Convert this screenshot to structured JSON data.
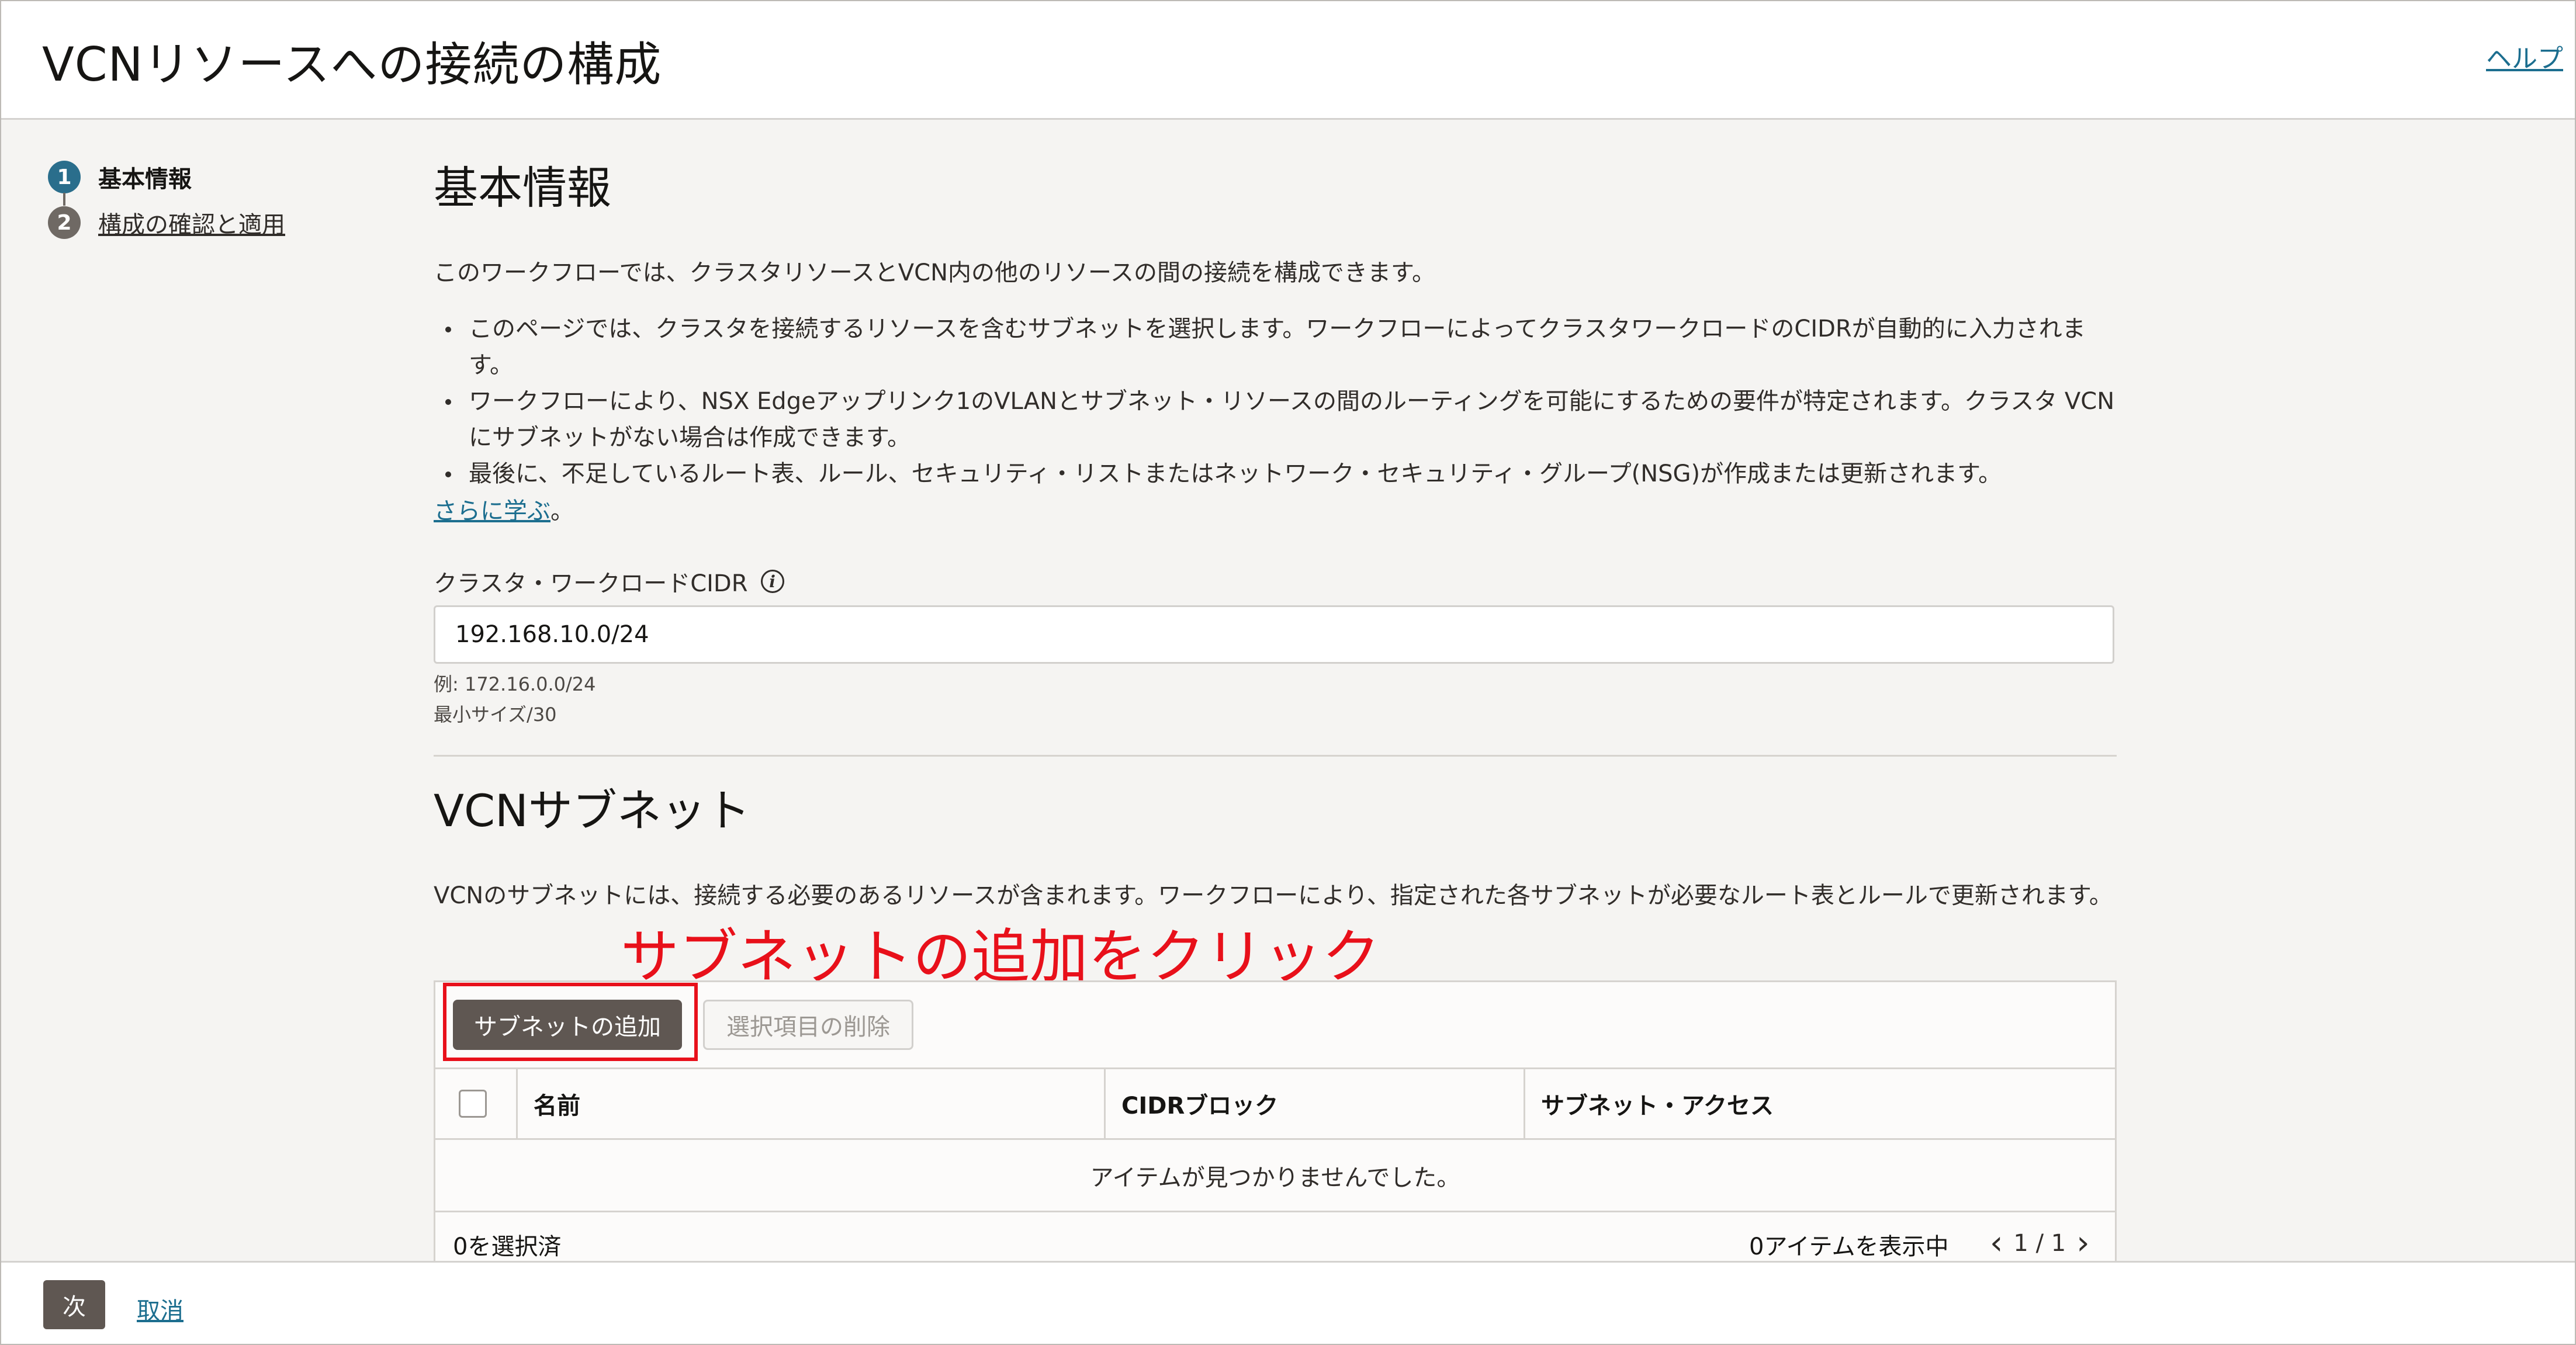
{
  "header": {
    "title": "VCNリソースへの接続の構成",
    "help": "ヘルプ"
  },
  "steps": [
    {
      "number": "1",
      "label": "基本情報",
      "state": "active"
    },
    {
      "number": "2",
      "label": "構成の確認と適用",
      "state": "inactive"
    }
  ],
  "basic": {
    "heading": "基本情報",
    "intro": "このワークフローでは、クラスタリソースとVCN内の他のリソースの間の接続を構成できます。",
    "bullets": [
      "このページでは、クラスタを接続するリソースを含むサブネットを選択します。ワークフローによってクラスタワークロードのCIDRが自動的に入力されます。",
      "ワークフローにより、NSX Edgeアップリンク1のVLANとサブネット・リソースの間のルーティングを可能にするための要件が特定されます。クラスタ VCNにサブネットがない場合は作成できます。",
      "最後に、不足しているルート表、ルール、セキュリティ・リストまたはネットワーク・セキュリティ・グループ(NSG)が作成または更新されます。"
    ],
    "learn_more": "さらに学ぶ",
    "learn_more_suffix": "。",
    "cidr_label": "クラスタ・ワークロードCIDR",
    "cidr_value": "192.168.10.0/24",
    "hint_example": "例: 172.16.0.0/24",
    "hint_min": "最小サイズ/30"
  },
  "subnets": {
    "heading": "VCNサブネット",
    "description": "VCNのサブネットには、接続する必要のあるリソースが含まれます。ワークフローにより、指定された各サブネットが必要なルート表とルールで更新されます。",
    "annotation": "サブネットの追加をクリック",
    "add_button": "サブネットの追加",
    "delete_button": "選択項目の削除",
    "columns": [
      "名前",
      "CIDRブロック",
      "サブネット・アクセス"
    ],
    "empty": "アイテムが見つかりませんでした。",
    "selected": "0を選択済",
    "showing": "0アイテムを表示中",
    "page": "1 / 1"
  },
  "footer": {
    "next": "次",
    "cancel": "取消"
  },
  "colors": {
    "accent": "#1c6e8f",
    "annotation": "#e8101a",
    "primary_button": "#5f5752"
  }
}
